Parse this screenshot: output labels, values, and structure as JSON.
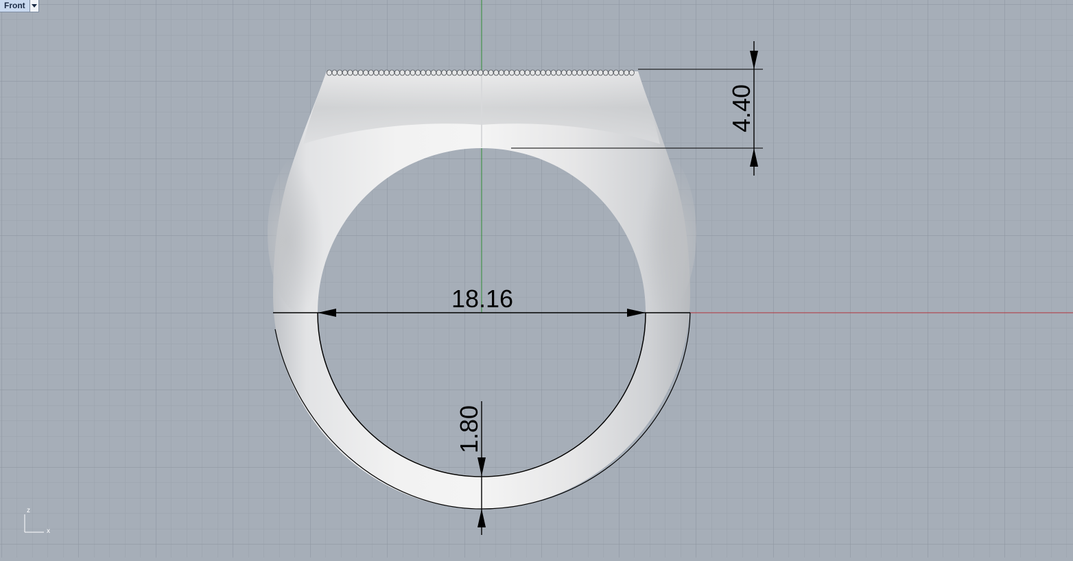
{
  "viewport": {
    "name": "Front",
    "menu_icon": "chevron-down-icon"
  },
  "dimensions": {
    "inner_diameter": "18.16",
    "top_height": "4.40",
    "shank_thickness": "1.80"
  },
  "axis_widget": {
    "vertical": "z",
    "horizontal": "x"
  },
  "colors": {
    "background": "#a6aeb8",
    "grid_minor": "#9ba3ad",
    "grid_major": "#8c949f",
    "x_axis": "#b3333a",
    "z_axis": "#2e8c35",
    "dimension": "#000000"
  }
}
